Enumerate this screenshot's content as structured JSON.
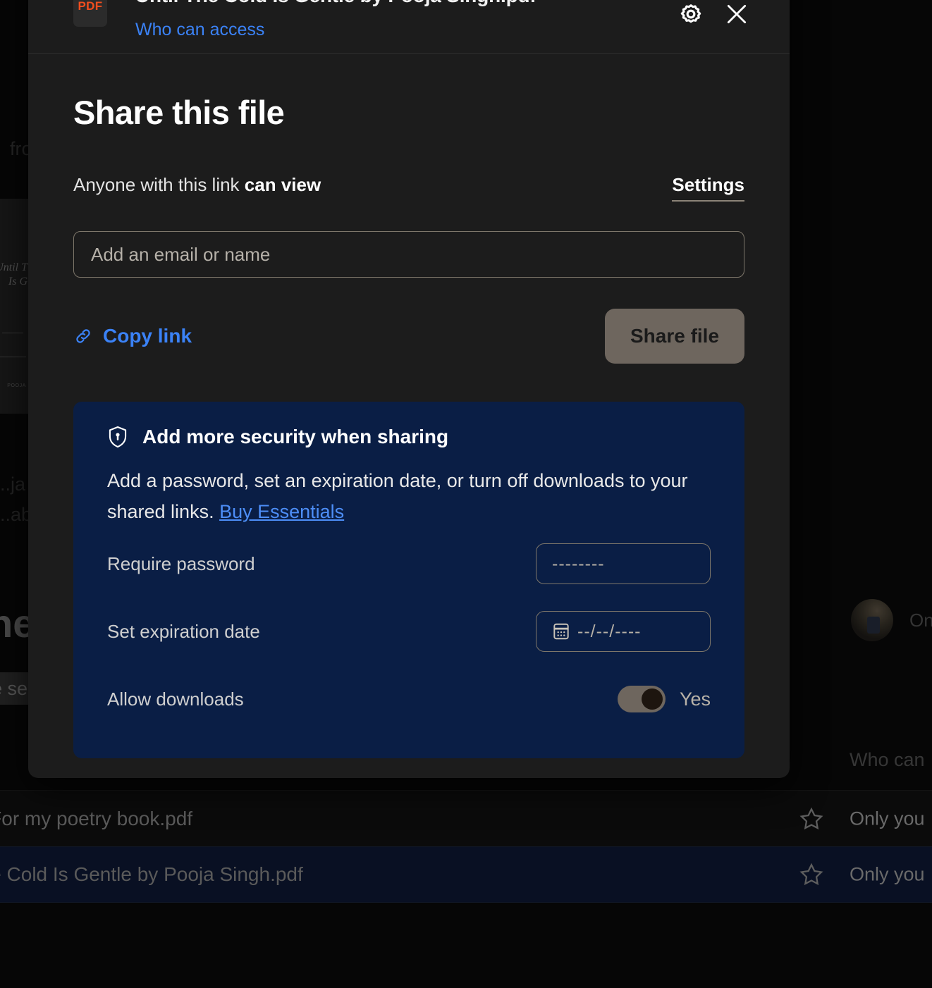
{
  "modal": {
    "file_badge": "PDF",
    "file_title": "Until The Cold Is Gentle by Pooja Singh.pdf",
    "who_can_access": "Who can access",
    "settings_icon": "gear-icon",
    "close_icon": "close-icon",
    "title": "Share this file",
    "link_status_prefix": "Anyone with this link ",
    "link_status_permission": "can view",
    "settings_label": "Settings",
    "email_placeholder": "Add an email or name",
    "email_value": "",
    "copy_link_label": "Copy link",
    "copy_link_icon": "link-chain-icon",
    "share_file_label": "Share file"
  },
  "security": {
    "shield_icon": "shield-keyhole-icon",
    "heading": "Add more security when sharing",
    "description": "Add a password, set an expiration date, or turn off downloads to your shared links. ",
    "upsell_link": "Buy Essentials",
    "rows": {
      "password_label": "Require password",
      "password_placeholder": "--------",
      "expiration_label": "Set expiration date",
      "expiration_icon": "calendar-icon",
      "expiration_placeholder": "--/--/----",
      "downloads_label": "Allow downloads",
      "downloads_value": "Yes"
    },
    "panel_color": "#0a1e45",
    "link_color": "#4d8ef7"
  },
  "background": {
    "breadcrumb_fragment": "fro",
    "preview_title_line1": "Until T",
    "preview_title_line2": "Is G",
    "preview_footer": "POOJA",
    "tag_fragment_1": "..ja",
    "tag_fragment_2": "..abl",
    "big_word_fragment": "ne",
    "search_fragment": "e se",
    "owner_fragment": "On",
    "who_can_fragment": "Who can",
    "rows": [
      {
        "name": "ple For my poetry book.pdf",
        "access": "Only you",
        "star_icon": "star-outline-icon"
      },
      {
        "name": "l The Cold Is Gentle by Pooja Singh.pdf",
        "access": "Only you",
        "star_icon": "star-outline-icon"
      }
    ]
  }
}
